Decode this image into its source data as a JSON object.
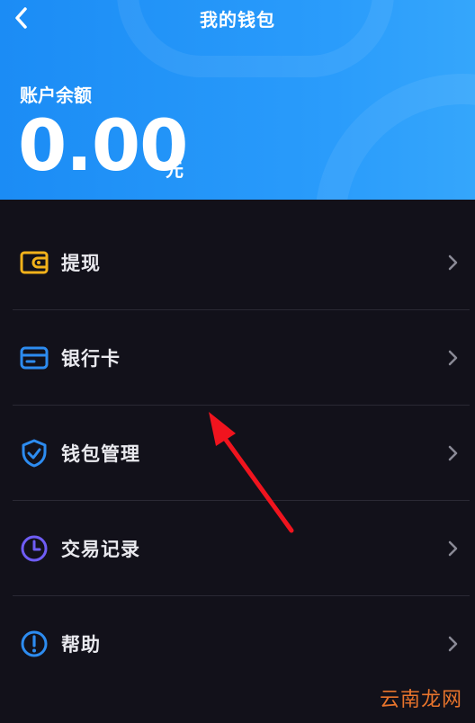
{
  "header": {
    "title": "我的钱包",
    "balance_label": "账户余额",
    "balance_amount": "0.00",
    "balance_unit": "元"
  },
  "menu": {
    "items": [
      {
        "label": "提现",
        "icon": "wallet-icon",
        "color": "#f2b21b"
      },
      {
        "label": "银行卡",
        "icon": "bank-card-icon",
        "color": "#2d8cf0"
      },
      {
        "label": "钱包管理",
        "icon": "shield-check-icon",
        "color": "#2d8cf0"
      },
      {
        "label": "交易记录",
        "icon": "clock-icon",
        "color": "#6f5df5"
      },
      {
        "label": "帮助",
        "icon": "help-icon",
        "color": "#2d8cf0"
      }
    ]
  },
  "watermark": "云南龙网",
  "colors": {
    "header_gradient_start": "#1b8cf5",
    "header_gradient_end": "#35a6fb",
    "background": "#12111a",
    "annotation_arrow": "#f0141e"
  }
}
